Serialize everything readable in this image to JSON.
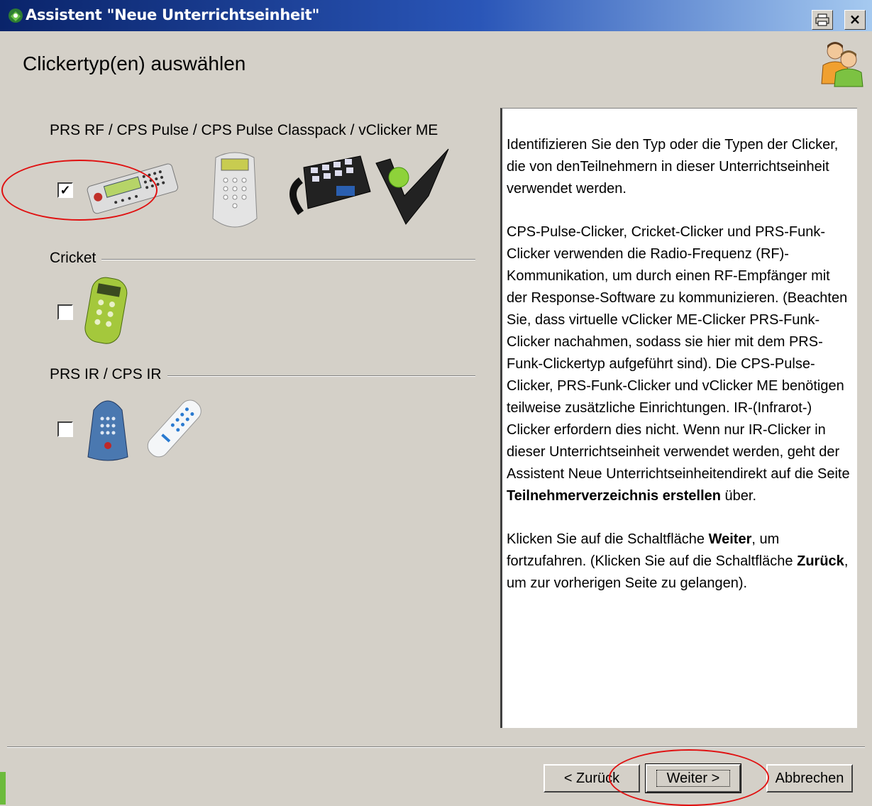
{
  "window": {
    "title": "Assistent \"Neue Unterrichtseinheit\"",
    "print_icon": "printer-icon",
    "close_label": "×"
  },
  "page": {
    "title": "Clickertyp(en) auswählen"
  },
  "groups": [
    {
      "label": "PRS RF / CPS Pulse / CPS Pulse Classpack / vClicker ME",
      "checked": true,
      "mark": "✓"
    },
    {
      "label": "Cricket",
      "checked": false,
      "mark": ""
    },
    {
      "label": "PRS IR / CPS IR",
      "checked": false,
      "mark": ""
    }
  ],
  "help": {
    "p1": "Identifizieren Sie den Typ oder die Typen der Clicker, die von denTeilnehmern in dieser Unterrichtseinheit verwendet werden.",
    "p2_text": "CPS-Pulse-Clicker, Cricket-Clicker und PRS-Funk-Clicker verwenden die Radio-Frequenz (RF)-Kommunikation, um durch einen RF-Empfänger mit der Response-Software zu kommunizieren. (Beachten Sie, dass virtuelle vClicker ME-Clicker PRS-Funk-Clicker nachahmen, sodass sie hier mit dem PRS-Funk-Clickertyp aufgeführt sind). Die CPS-Pulse-Clicker, PRS-Funk-Clicker und vClicker ME benötigen teilweise zusätzliche Einrichtungen. IR-(Infrarot-) Clicker erfordern dies nicht. Wenn nur IR-Clicker in dieser Unterrichtseinheit verwendet werden, geht der Assistent Neue Unterrichtseinheitendirekt auf die Seite ",
    "p2_bold": "Teilnehmerverzeichnis erstellen",
    "p2_end": " über.",
    "p3_a": "Klicken Sie auf die Schaltfläche ",
    "p3_bold1": "Weiter",
    "p3_b": ", um fortzufahren. (Klicken Sie auf die Schaltfläche ",
    "p3_bold2": "Zurück",
    "p3_c": ", um zur vorherigen Seite zu gelangen)."
  },
  "buttons": {
    "back": "< Zurück",
    "next": "Weiter >",
    "cancel": "Abbrechen"
  },
  "colors": {
    "annotation_circle": "#e01010",
    "titlebar": "#0a246a"
  }
}
